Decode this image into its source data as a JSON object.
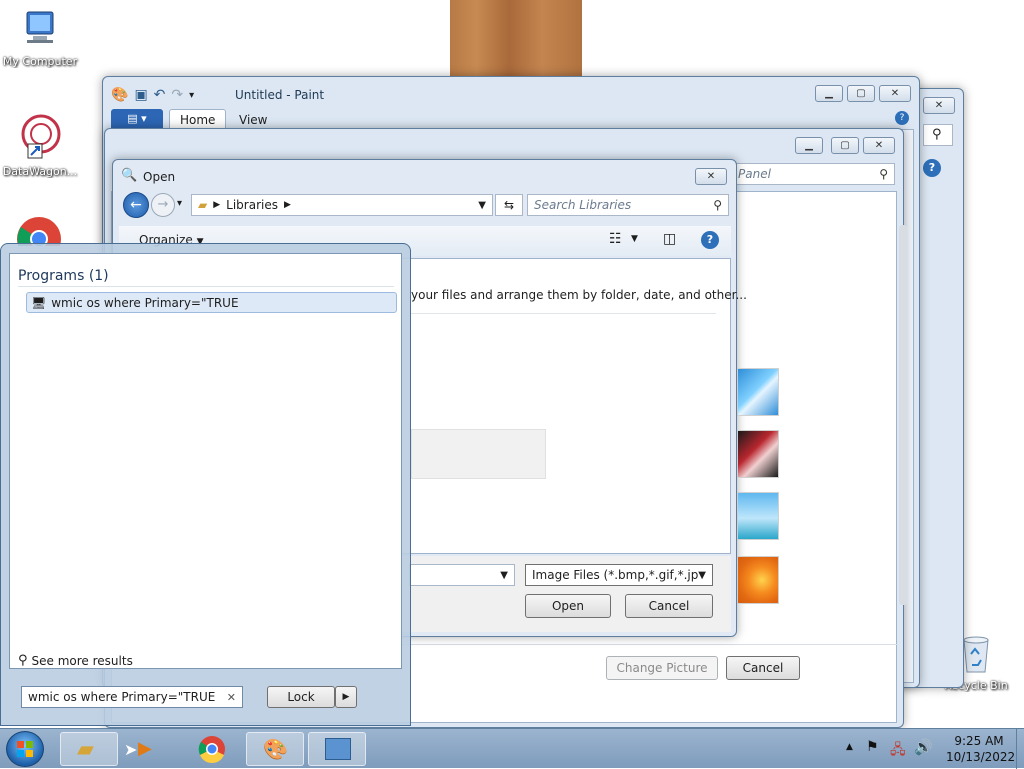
{
  "desktop": {
    "icons": [
      {
        "label": "My Computer",
        "icon": "computer-icon"
      },
      {
        "label": "DataWagon...",
        "icon": "datawagon-icon"
      },
      {
        "label": "Recycle Bin",
        "icon": "recycle-bin-icon"
      }
    ]
  },
  "paint": {
    "title": "Untitled - Paint",
    "tabs": [
      "Home",
      "View"
    ]
  },
  "control_panel": {
    "search_placeholder": "Panel",
    "change_picture_label": "Change Picture",
    "cancel_label": "Cancel"
  },
  "open_dialog": {
    "title": "Open",
    "breadcrumb": "Libraries",
    "search_placeholder": "Search Libraries",
    "organize_label": "Organize",
    "info_text": "your files and arrange them by folder, date, and other...",
    "filetype_value": "Image Files (*.bmp,*.gif,*.jpg,*.",
    "open_label": "Open",
    "cancel_label": "Cancel"
  },
  "start_menu": {
    "section_header": "Programs (1)",
    "result_label": "wmic os where Primary=\"TRUE",
    "see_more_label": "See more results",
    "search_value": "wmic os where Primary=\"TRUE",
    "lock_label": "Lock"
  },
  "taskbar": {
    "time": "9:25 AM",
    "date": "10/13/2022"
  }
}
